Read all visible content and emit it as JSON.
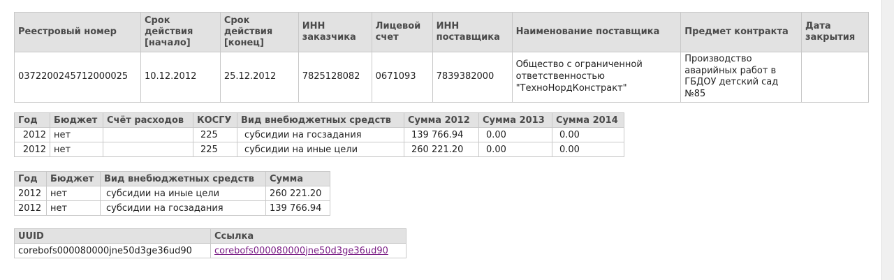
{
  "contract_table": {
    "headers": [
      "Реестровый номер",
      "Срок действия [начало]",
      "Срок действия [конец]",
      "ИНН заказчика",
      "Лицевой счет",
      "ИНН поставщика",
      "Наименование поставщика",
      "Предмет контракта",
      "Дата закрытия"
    ],
    "row": [
      "0372200245712000025",
      "10.12.2012",
      "25.12.2012",
      "7825128082",
      "0671093",
      "7839382000",
      "Общество с ограниченной ответственностью \"ТехноНордКонстракт\"",
      "Производство аварийных работ в ГБДОУ детский сад №85",
      ""
    ]
  },
  "budget_table": {
    "headers": [
      "Год",
      "Бюджет",
      "Счёт расходов",
      "КОСГУ",
      "Вид внебюджетных средств",
      "Сумма 2012",
      "Сумма 2013",
      "Сумма 2014"
    ],
    "rows": [
      [
        "2012",
        "нет",
        "",
        "225",
        "субсидии на госзадания",
        "139 766.94",
        "0.00",
        "0.00"
      ],
      [
        "2012",
        "нет",
        "",
        "225",
        "субсидии на иные цели",
        "260 221.20",
        "0.00",
        "0.00"
      ]
    ]
  },
  "funds_table": {
    "headers": [
      "Год",
      "Бюджет",
      "Вид внебюджетных средств",
      "Сумма"
    ],
    "rows": [
      [
        "2012",
        "нет",
        "субсидии на иные цели",
        "260 221.20"
      ],
      [
        "2012",
        "нет",
        "субсидии на госзадания",
        "139 766.94"
      ]
    ]
  },
  "links_table": {
    "headers": [
      "UUID",
      "Ссылка"
    ],
    "rows": [
      [
        "corebofs000080000jne50d3ge36ud90",
        "corebofs000080000jne50d3ge36ud90"
      ]
    ]
  },
  "colors": {
    "header_bg": "#e2e2e2",
    "border": "#c8c8c8",
    "link": "#7b1f86"
  }
}
